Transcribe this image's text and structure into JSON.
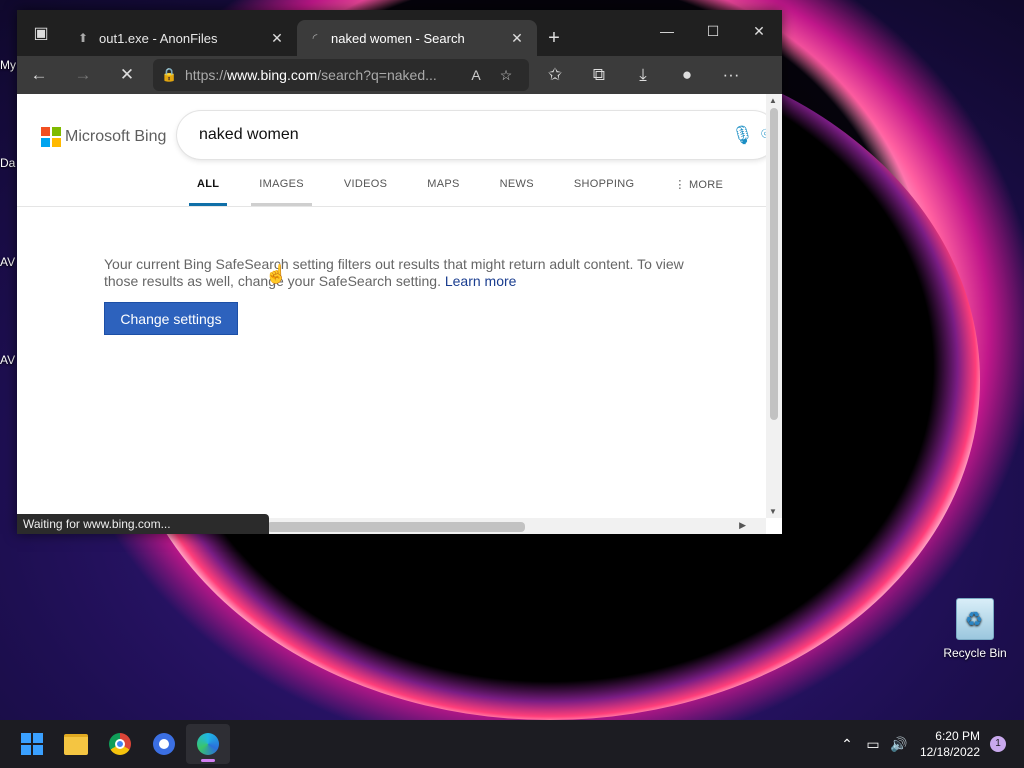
{
  "desktop": {
    "left_icon_fragments": [
      "My",
      "Da",
      "AV",
      "AV"
    ],
    "recycle_bin_label": "Recycle Bin"
  },
  "browser": {
    "tabs": [
      {
        "title": "out1.exe - AnonFiles",
        "favicon": "anonfiles-icon",
        "active": false
      },
      {
        "title": "naked women - Search",
        "favicon": "loading-icon",
        "active": true
      }
    ],
    "address": {
      "prefix": "https://",
      "host": "www.bing.com",
      "path": "/search?q=naked..."
    },
    "status_text": "Waiting for www.bing.com..."
  },
  "bing": {
    "logo_text": "Microsoft Bing",
    "query": "naked women",
    "scopes": [
      "ALL",
      "IMAGES",
      "VIDEOS",
      "MAPS",
      "NEWS",
      "SHOPPING"
    ],
    "more_label": "MORE",
    "safesearch_message": "Your current Bing SafeSearch setting filters out results that might return adult content. To view those results as well, change your SafeSearch setting.",
    "learn_more": "Learn more",
    "change_settings": "Change settings",
    "logo_colors": [
      "#f25022",
      "#7fba00",
      "#00a4ef",
      "#ffb900"
    ]
  },
  "taskbar": {
    "time": "6:20 PM",
    "date": "12/18/2022",
    "notification_count": "1"
  }
}
